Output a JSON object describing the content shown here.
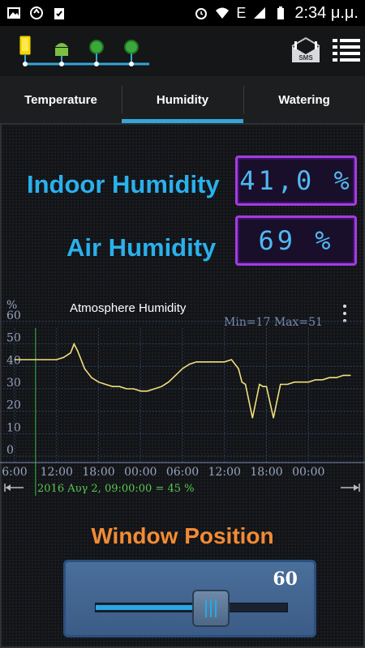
{
  "status_bar": {
    "time": "2:34 μ.μ.",
    "network": "E",
    "icons": [
      "gallery-icon",
      "sync-icon",
      "clipboard-icon",
      "alarm-icon",
      "wifi-icon",
      "signal-icon",
      "battery-icon"
    ]
  },
  "header": {
    "icons": [
      "phone-icon",
      "android-icon",
      "sensor-icon",
      "sensor-icon",
      "sms-icon",
      "menu-icon"
    ],
    "sms_label": "SMS"
  },
  "tabs": [
    {
      "label": "Temperature",
      "active": false
    },
    {
      "label": "Humidity",
      "active": true
    },
    {
      "label": "Watering",
      "active": false
    }
  ],
  "indoor": {
    "label": "Indoor Humidity",
    "value": "41,0 %"
  },
  "air": {
    "label": "Air Humidity",
    "value": "69 %"
  },
  "chart": {
    "title": "Atmosphere Humidity",
    "unit": "%",
    "minmax": "Min=17  Max=51",
    "status": "2016 Αυγ 2, 09:00:00 = 45 %"
  },
  "chart_data": {
    "type": "line",
    "title": "Atmosphere Humidity",
    "ylabel": "%",
    "ylim": [
      0,
      60
    ],
    "yticks": [
      "0",
      "10",
      "20",
      "30",
      "40",
      "50",
      "60"
    ],
    "xticks": [
      "6:00",
      "12:00",
      "18:00",
      "00:00",
      "06:00",
      "12:00",
      "18:00",
      "00:00"
    ],
    "grid": true,
    "series": [
      {
        "x_hours": [
          6,
          7,
          8,
          9,
          10,
          11,
          12,
          13,
          14,
          14.5,
          15,
          16,
          17,
          18,
          19,
          20,
          21,
          22,
          23,
          24,
          25,
          26,
          27,
          28,
          29,
          30,
          31,
          32,
          33,
          34,
          35,
          36,
          37,
          38,
          38.5,
          39,
          40,
          41,
          41.5,
          42,
          43,
          44,
          45,
          46,
          47,
          48,
          49,
          50,
          51,
          52,
          53,
          54
        ],
        "values": [
          43,
          43,
          43,
          43,
          43,
          43,
          43,
          44,
          46,
          50,
          47,
          39,
          35,
          33,
          32,
          31,
          31,
          30,
          30,
          29,
          29,
          30,
          31,
          33,
          36,
          39,
          41,
          42,
          42,
          42,
          42,
          42,
          43,
          39,
          33,
          32,
          17,
          32,
          31,
          31,
          17,
          32,
          32,
          33,
          33,
          33,
          34,
          34,
          35,
          35,
          36,
          36
        ]
      }
    ],
    "cursor_x_hours": 9,
    "cursor_value": 45,
    "min": 17,
    "max": 51
  },
  "window_position": {
    "title": "Window Position",
    "value": "60",
    "level_percent": 60
  },
  "colors": {
    "accent": "#2ab0ec",
    "readout_border": "#a53ce0",
    "chart_line": "#f2e07a",
    "title_orange": "#f38b34",
    "cursor_green": "#3fbf3f"
  }
}
